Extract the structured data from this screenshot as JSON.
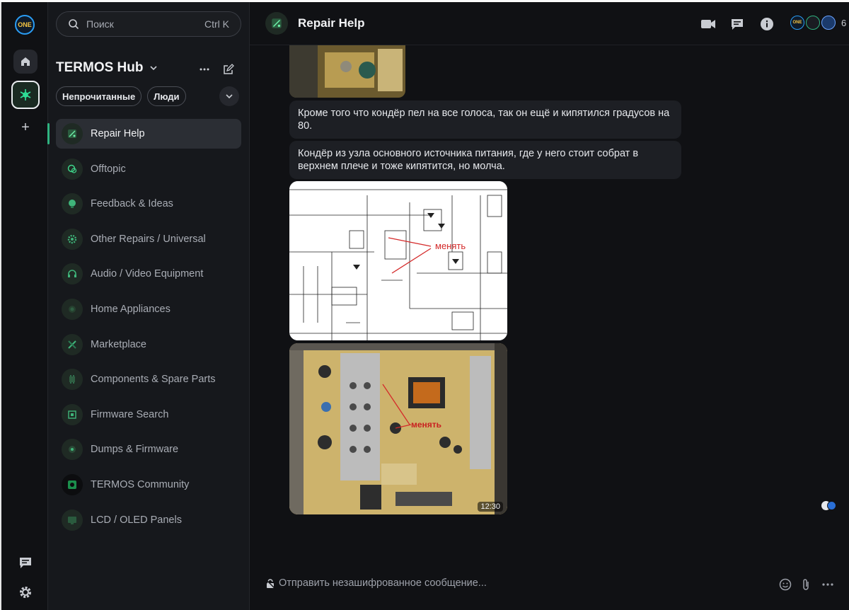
{
  "rail": {
    "logo_text": "ONE",
    "add_label": "+"
  },
  "sidebar": {
    "search": {
      "placeholder": "Поиск",
      "shortcut": "Ctrl K"
    },
    "space_name": "TERMOS Hub",
    "filters": [
      "Непрочитанные",
      "Люди"
    ],
    "rooms": [
      {
        "label": "Repair Help",
        "icon": "circuit-board-icon",
        "active": true
      },
      {
        "label": "Offtopic",
        "icon": "chat-bubbles-icon",
        "active": false
      },
      {
        "label": "Feedback & Ideas",
        "icon": "lightbulb-icon",
        "active": false
      },
      {
        "label": "Other Repairs / Universal",
        "icon": "gear-icon",
        "active": false
      },
      {
        "label": "Audio / Video Equipment",
        "icon": "headphones-icon",
        "active": false
      },
      {
        "label": "Home Appliances",
        "icon": "appliance-icon",
        "active": false
      },
      {
        "label": "Marketplace",
        "icon": "tools-icon",
        "active": false
      },
      {
        "label": "Components & Spare Parts",
        "icon": "chip-icon",
        "active": false
      },
      {
        "label": "Firmware Search",
        "icon": "search-chip-icon",
        "active": false
      },
      {
        "label": "Dumps & Firmware",
        "icon": "database-icon",
        "active": false
      },
      {
        "label": "TERMOS Community",
        "icon": "termos-logo-icon",
        "active": false
      },
      {
        "label": "LCD / OLED Panels",
        "icon": "display-icon",
        "active": false
      }
    ]
  },
  "header": {
    "room_title": "Repair Help",
    "member_count": "6",
    "member_badge_text": "ONE"
  },
  "timeline": {
    "messages": [
      {
        "text": "Кроме того что кондёр пел на все голоса, так он ещё и кипятился градусов на 80."
      },
      {
        "text": "Кондёр из узла основного источника питания, где у него стоит собрат в верхнем плече и тоже кипятится, но молча."
      }
    ],
    "schematic_annotation": "менять",
    "board_annotation": "менять",
    "photo_time": "12:30"
  },
  "composer": {
    "placeholder": "Отправить незашифрованное сообщение..."
  },
  "colors": {
    "accent": "#2fb380",
    "background": "#101114",
    "sidebar": "#16181c",
    "bubble": "#1d1f24"
  }
}
